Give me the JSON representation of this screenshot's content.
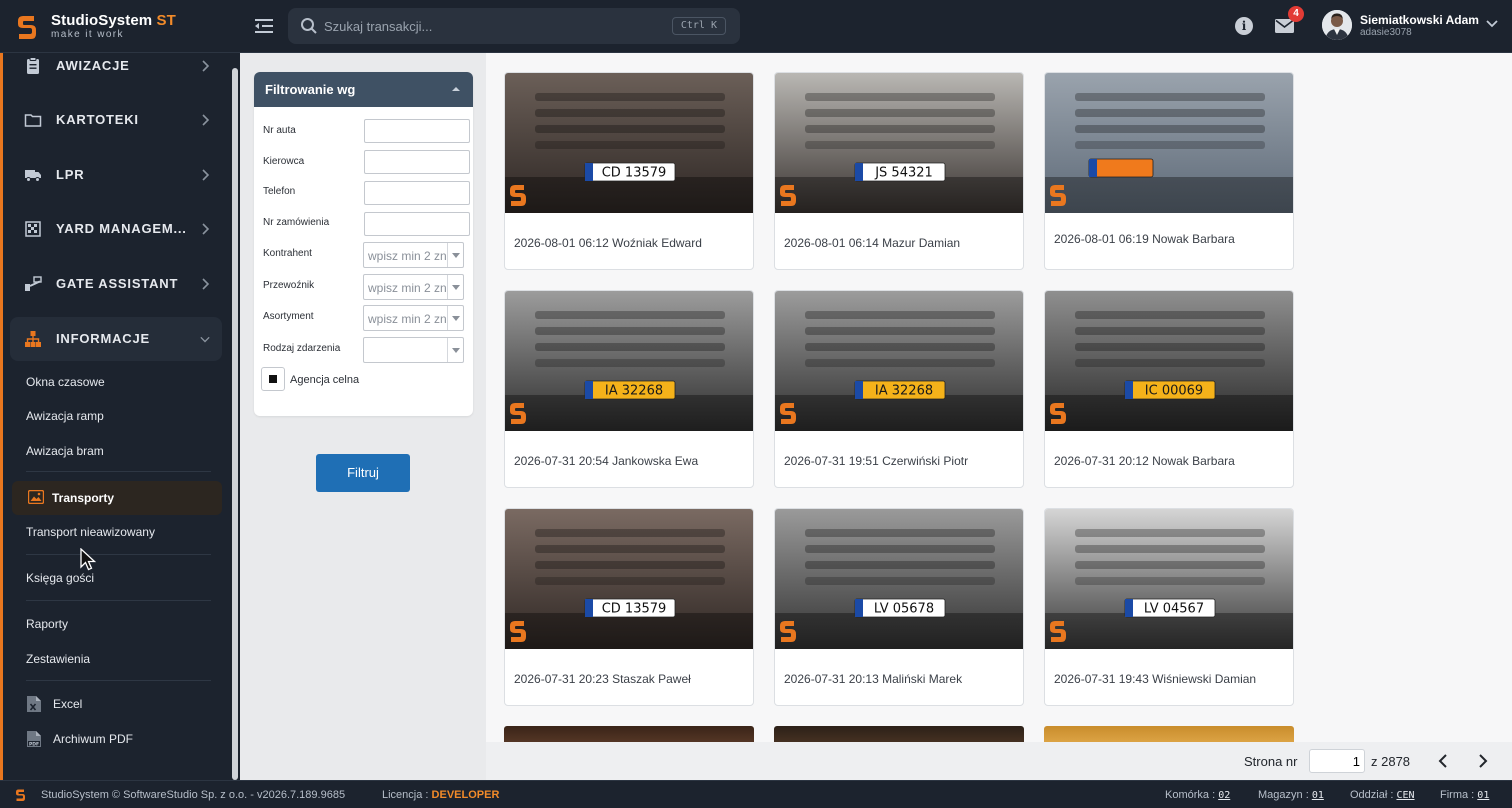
{
  "app": {
    "brand_name": "StudioSystem",
    "brand_suffix": "ST",
    "tagline": "make it work"
  },
  "header": {
    "search_placeholder": "Szukaj transakcji...",
    "search_shortcut": "Ctrl K",
    "info_symbol": "i",
    "mail_badge": "4",
    "user_name": "Siemiatkowski Adam",
    "user_login": "adasie3078"
  },
  "sidebar": {
    "groups": [
      {
        "label": "AWIZACJE",
        "icon": "clipboard-icon"
      },
      {
        "label": "KARTOTEKI",
        "icon": "folder-icon"
      },
      {
        "label": "LPR",
        "icon": "truck-icon"
      },
      {
        "label": "YARD MANAGEM...",
        "icon": "grid-icon"
      },
      {
        "label": "GATE ASSISTANT",
        "icon": "gate-icon"
      },
      {
        "label": "INFORMACJE",
        "icon": "sitemap-icon"
      }
    ],
    "sub_items": [
      "Okna czasowe",
      "Awizacja ramp",
      "Awizacja bram",
      "Transporty",
      "Transport nieawizowany",
      "Księga gości",
      "Raporty",
      "Zestawienia",
      "Excel",
      "Archiwum PDF"
    ]
  },
  "filter": {
    "title": "Filtrowanie wg",
    "fields": [
      {
        "label": "Nr auta",
        "value": ""
      },
      {
        "label": "Kierowca",
        "value": ""
      },
      {
        "label": "Telefon",
        "value": ""
      },
      {
        "label": "Nr zamówienia",
        "value": ""
      }
    ],
    "selects": [
      {
        "label": "Kontrahent",
        "placeholder": "wpisz min 2 znaki"
      },
      {
        "label": "Przewoźnik",
        "placeholder": "wpisz min 2 znaki"
      },
      {
        "label": "Asortyment",
        "placeholder": "wpisz min 2 znaki"
      },
      {
        "label": "Rodzaj zdarzenia",
        "placeholder": ""
      }
    ],
    "checkbox_label": "Agencja celna",
    "checkbox_checked": true,
    "button_label": "Filtruj"
  },
  "transports": [
    {
      "caption": "2026-08-01 06:12 Woźniak Edward",
      "plate": "CD 13579",
      "plate_style": "white"
    },
    {
      "caption": "2026-08-01 06:14 Mazur Damian",
      "plate": "JS 54321",
      "plate_style": "white"
    },
    {
      "caption": "2026-08-01 06:19 Nowak Barbara",
      "plate": "",
      "plate_style": "orange"
    },
    {
      "caption": "2026-07-31 20:54 Jankowska Ewa",
      "plate": "IA 32268",
      "plate_style": "yellow"
    },
    {
      "caption": "2026-07-31 19:51 Czerwiński Piotr",
      "plate": "IA 32268",
      "plate_style": "yellow"
    },
    {
      "caption": "2026-07-31 20:12 Nowak Barbara",
      "plate": "IC 00069",
      "plate_style": "yellow"
    },
    {
      "caption": "2026-07-31 20:23 Staszak Paweł",
      "plate": "CD 13579",
      "plate_style": "white"
    },
    {
      "caption": "2026-07-31 20:13 Maliński Marek",
      "plate": "LV 05678",
      "plate_style": "white"
    },
    {
      "caption": "2026-07-31 19:43 Wiśniewski Damian",
      "plate": "LV 04567",
      "plate_style": "white"
    }
  ],
  "pager": {
    "label": "Strona nr",
    "current": "1",
    "total_text": "z 2878"
  },
  "status": {
    "copyright": "StudioSystem © SoftwareStudio Sp. z o.o. - v2026.7.189.9685",
    "license_label": "Licencja :",
    "license_value": "DEVELOPER",
    "komorka_label": "Komórka :",
    "komorka_value": "02",
    "magazyn_label": "Magazyn :",
    "magazyn_value": "01",
    "oddzial_label": "Oddział :",
    "oddzial_value": "CEN",
    "firma_label": "Firma :",
    "firma_value": "01"
  },
  "colors": {
    "accent": "#e9771f",
    "header_bg": "#1c232e",
    "filter_head": "#3f5164",
    "button": "#1f6fb5",
    "badge": "#e23b35"
  }
}
